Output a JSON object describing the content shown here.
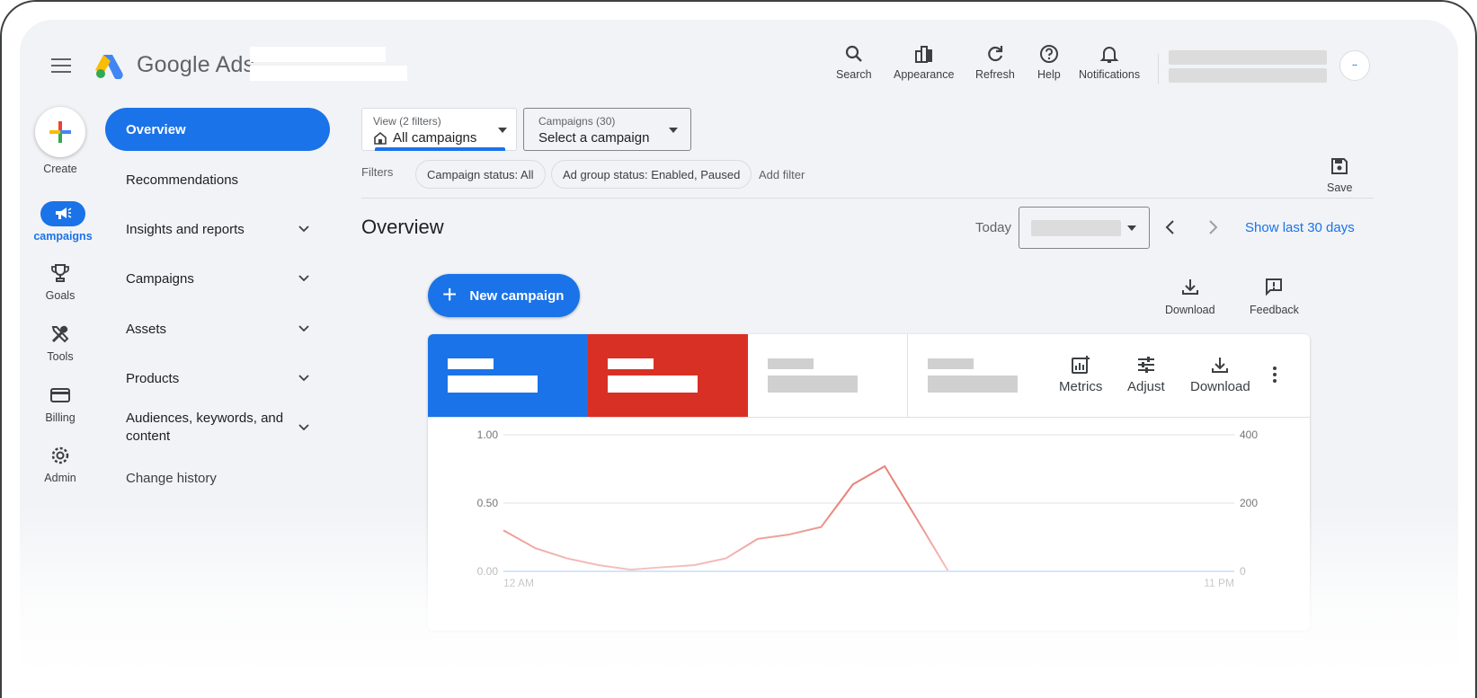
{
  "header": {
    "brand": "Google Ads",
    "toolbar": [
      {
        "label": "Search",
        "icon": "search-icon"
      },
      {
        "label": "Appearance",
        "icon": "appearance-icon"
      },
      {
        "label": "Refresh",
        "icon": "refresh-icon"
      },
      {
        "label": "Help",
        "icon": "help-icon"
      },
      {
        "label": "Notifications",
        "icon": "bell-icon"
      }
    ]
  },
  "rail": {
    "create": "Create",
    "campaigns": "campaigns",
    "goals": "Goals",
    "tools": "Tools",
    "billing": "Billing",
    "admin": "Admin"
  },
  "nav": {
    "items": [
      {
        "label": "Overview",
        "active": true
      },
      {
        "label": "Recommendations"
      },
      {
        "label": "Insights and reports",
        "expandable": true
      },
      {
        "label": "Campaigns",
        "expandable": true
      },
      {
        "label": "Assets",
        "expandable": true
      },
      {
        "label": "Products",
        "expandable": true
      },
      {
        "label": "Audiences, keywords, and content",
        "expandable": true
      },
      {
        "label": "Change history"
      }
    ]
  },
  "view": {
    "filters_label": "View (2 filters)",
    "value": "All campaigns",
    "campaigns_label": "Campaigns (30)",
    "campaigns_value": "Select a campaign"
  },
  "filters": {
    "label": "Filters",
    "chips": [
      "Campaign status: All",
      "Ad group status: Enabled, Paused"
    ],
    "add": "Add filter",
    "save": "Save"
  },
  "overview": {
    "title": "Overview",
    "today": "Today",
    "show_last": "Show last 30 days",
    "new_campaign": "New campaign",
    "download": "Download",
    "feedback": "Feedback"
  },
  "card_tools": {
    "metrics": "Metrics",
    "adjust": "Adjust",
    "download": "Download"
  },
  "colors": {
    "blue": "#1a73e8",
    "red": "#d93025",
    "line_red": "#e8837a",
    "line_blue": "#a8c7fa"
  },
  "chart_data": {
    "type": "line",
    "left_axis": {
      "ticks": [
        "1.00",
        "0.50",
        "0.00"
      ],
      "range": [
        0,
        1
      ]
    },
    "right_axis": {
      "ticks": [
        "400",
        "200",
        "0"
      ],
      "range": [
        0,
        400
      ]
    },
    "x_labels": [
      "12 AM",
      "11 PM"
    ],
    "x": [
      0,
      1,
      2,
      3,
      4,
      5,
      6,
      7,
      8,
      9,
      10,
      11,
      12,
      13,
      14,
      15,
      16,
      17,
      18,
      19,
      20,
      21,
      22,
      23
    ],
    "series": [
      {
        "axis": "right",
        "color": "#e8837a",
        "values": [
          120,
          68,
          38,
          18,
          5,
          12,
          18,
          38,
          95,
          108,
          130,
          255,
          308,
          155,
          0,
          0,
          0,
          0,
          0,
          0,
          0,
          0,
          0,
          0
        ]
      },
      {
        "axis": "left",
        "color": "#a8c7fa",
        "values": [
          0,
          0,
          0,
          0,
          0,
          0,
          0,
          0,
          0,
          0,
          0,
          0,
          0,
          0,
          0,
          0,
          0,
          0,
          0,
          0,
          0,
          0,
          0,
          0
        ]
      }
    ]
  }
}
